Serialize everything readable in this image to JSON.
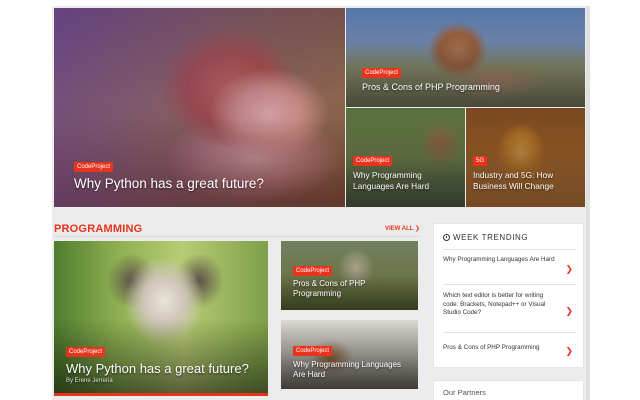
{
  "featured": {
    "main": {
      "tag": "CodeProject",
      "title": "Why Python has a great future?"
    },
    "top_right": {
      "tag": "CodeProject",
      "title": "Pros & Cons of PHP Programming"
    },
    "bottom_left": {
      "tag": "CodeProject",
      "title": "Why Programming Languages Are Hard"
    },
    "bottom_right": {
      "tag": "5G",
      "title": "Industry and 5G: How Business Will Change"
    }
  },
  "programming": {
    "heading": "PROGRAMMING",
    "view_all": "VIEW ALL ❯",
    "main": {
      "tag": "CodeProject",
      "title": "Why Python has a great future?",
      "author": "By Erene Jerreria"
    },
    "side1": {
      "tag": "CodeProject",
      "title": "Pros & Cons of PHP Programming"
    },
    "side2": {
      "tag": "CodeProject",
      "title": "Why Programming Languages Are Hard"
    }
  },
  "week_trending": {
    "heading": "WEEK TRENDING",
    "items": [
      {
        "title": "Why Programming Languages Are Hard"
      },
      {
        "title": "Which text editor is better for writing code: Brackets, Notepad++ or Visual Studio Code?"
      },
      {
        "title": "Pros & Cons of PHP Programming"
      }
    ]
  },
  "partners": {
    "heading": "Our Partners"
  },
  "colors": {
    "accent": "#e8341c"
  },
  "icons": {
    "trending": "clock-icon",
    "chevron": "chevron-right-icon"
  }
}
